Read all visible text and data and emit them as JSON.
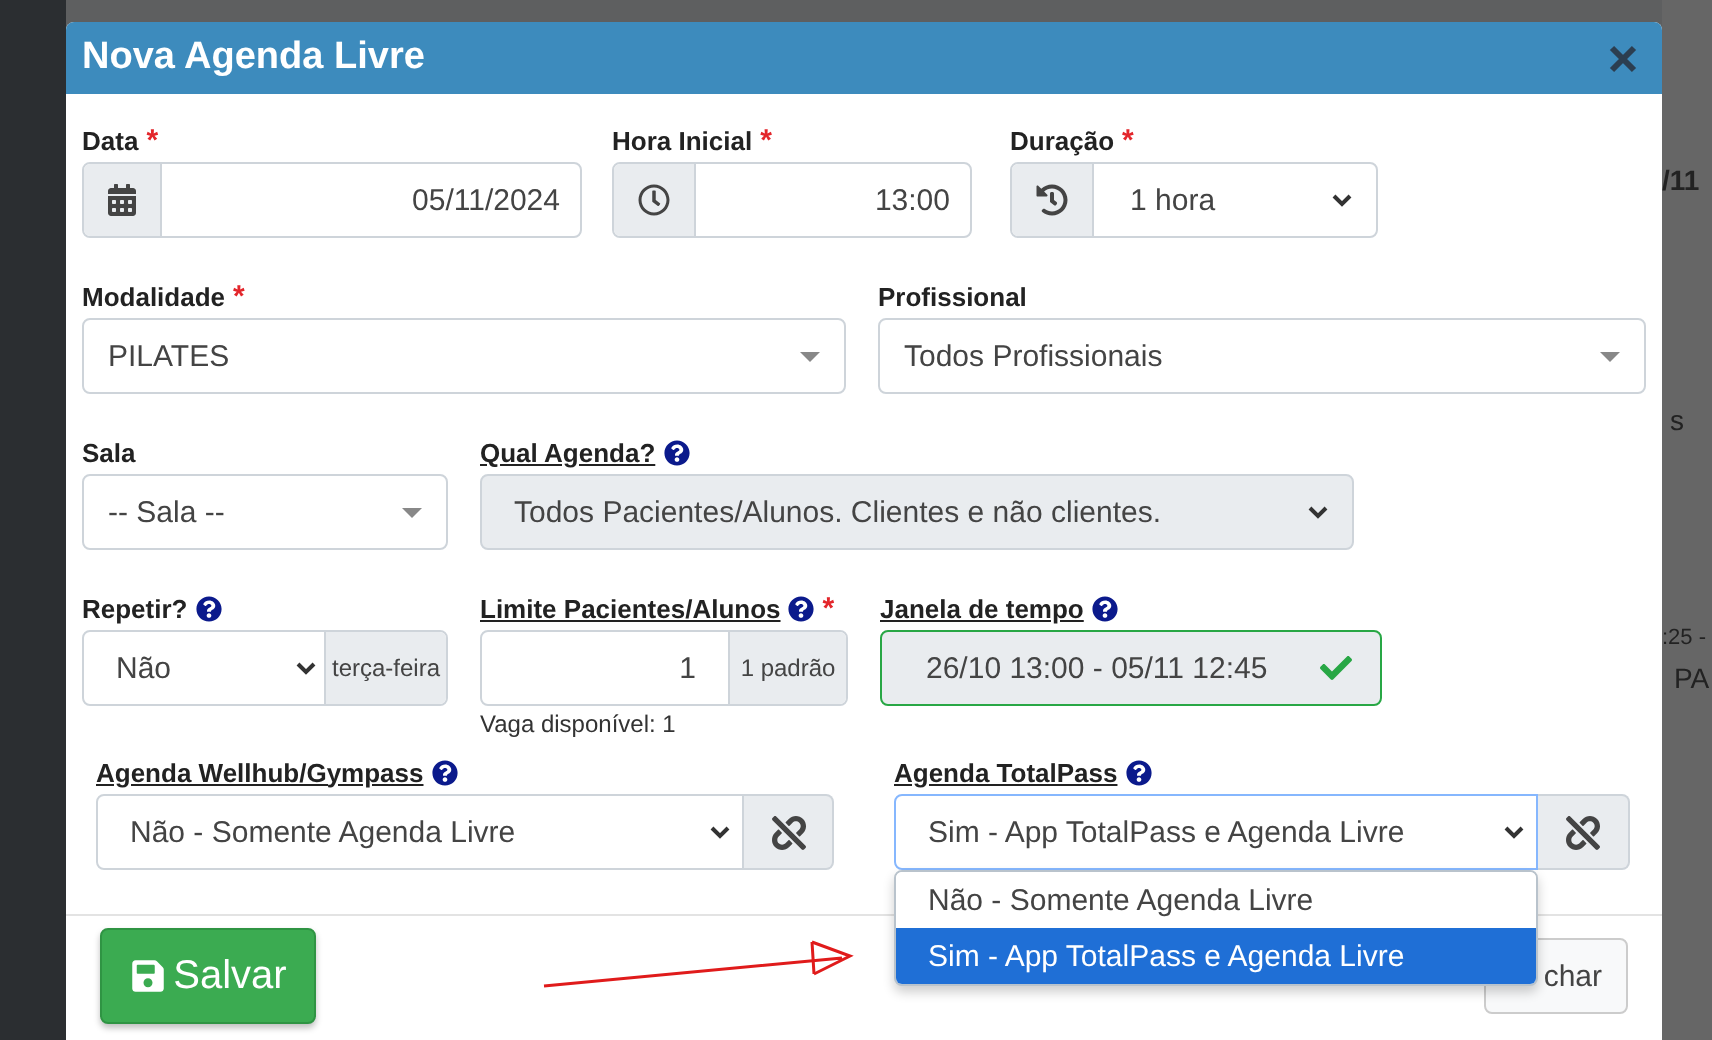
{
  "dialog": {
    "title": "Nova Agenda Livre"
  },
  "row1": [
    {
      "kind": "date",
      "label": "Data",
      "required": "*",
      "value": "05/11/2024"
    },
    {
      "kind": "time",
      "label": "Hora Inicial",
      "required": "*",
      "value": "13:00"
    },
    {
      "kind": "duration",
      "label": "Duração",
      "required": "*",
      "value": "1 hora"
    }
  ],
  "modalidade": {
    "label": "Modalidade",
    "required": "*",
    "value": "PILATES"
  },
  "profissional": {
    "label": "Profissional",
    "value": "Todos Profissionais"
  },
  "sala": {
    "label": "Sala",
    "value": "-- Sala --"
  },
  "qual_agenda": {
    "label": "Qual Agenda?",
    "help": true,
    "disabled": true,
    "value": "Todos Pacientes/Alunos. Clientes e não clientes."
  },
  "repetir": {
    "label": "Repetir?",
    "help": true,
    "value": "Não",
    "addon": "terça-feira"
  },
  "limite": {
    "label": "Limite Pacientes/Alunos",
    "help": true,
    "required": "*",
    "value": "1",
    "addon": "1 padrão",
    "hint": "Vaga disponível: 1"
  },
  "janela": {
    "label": "Janela de tempo",
    "help": true,
    "valid": true,
    "value": "26/10 13:00 - 05/11 12:45"
  },
  "wellhub": {
    "label": "Agenda Wellhub/Gympass",
    "help": true,
    "focused": false,
    "value": "Não - Somente Agenda Livre"
  },
  "totalpass": {
    "label": "Agenda TotalPass",
    "help": true,
    "focused": true,
    "value": "Sim - App TotalPass e Agenda Livre",
    "options": [
      {
        "label": "Não - Somente Agenda Livre",
        "selected": false
      },
      {
        "label": "Sim - App TotalPass e Agenda Livre",
        "selected": true
      }
    ]
  },
  "footer": {
    "save": "Salvar",
    "close": "char"
  },
  "background": {
    "fragments": [
      "/11",
      "s",
      ":25 -",
      "PA"
    ]
  }
}
